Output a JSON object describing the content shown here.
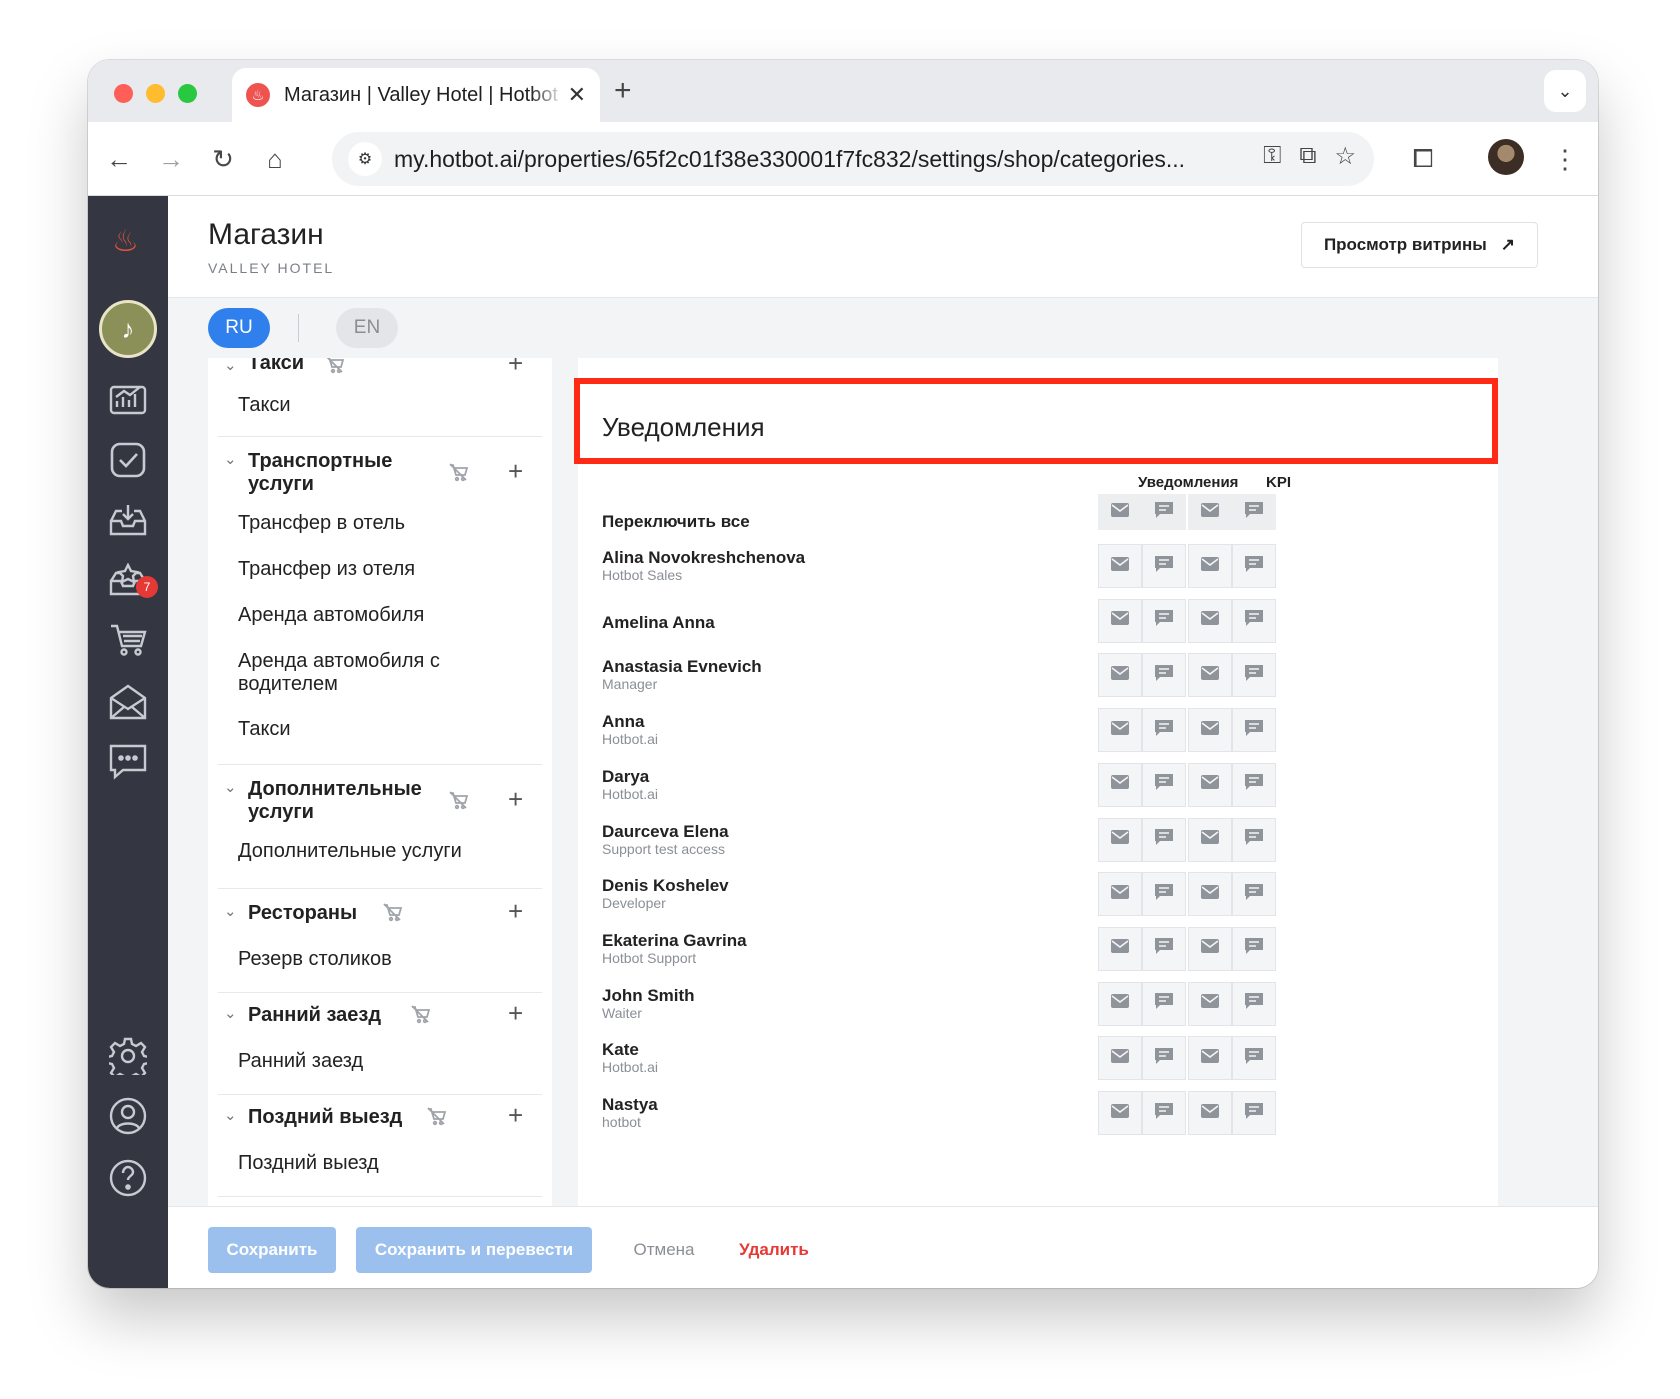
{
  "browser": {
    "tab_title": "Магазин | Valley Hotel | Hotbot",
    "url": "my.hotbot.ai/properties/65f2c01f38e330001f7fc832/settings/shop/categories...",
    "traffic_colors": [
      "#ff5f57",
      "#febc2e",
      "#28c840"
    ]
  },
  "header": {
    "title": "Магазин",
    "subtitle": "VALLEY HOTEL",
    "showcase_button": "Просмотр витрины",
    "showcase_arrow": "↗"
  },
  "languages": [
    {
      "code": "RU",
      "active": true
    },
    {
      "code": "EN",
      "active": false
    }
  ],
  "sidebar": {
    "badge_count": "7",
    "items": [
      "analytics-icon",
      "tasks-icon",
      "inbox-icon",
      "reviews-icon",
      "cart-icon",
      "mail-icon",
      "chat-icon",
      "settings-icon",
      "profile-icon",
      "help-icon"
    ]
  },
  "categories": [
    {
      "name": "Такси",
      "items": [
        "Такси"
      ]
    },
    {
      "name": "Транспортные услуги",
      "items": [
        "Трансфер в отель",
        "Трансфер из отеля",
        "Аренда автомобиля",
        "Аренда автомобиля с водителем",
        "Такси"
      ]
    },
    {
      "name": "Дополнительные услуги",
      "items": [
        "Дополнительные услуги"
      ]
    },
    {
      "name": "Рестораны",
      "items": [
        "Резерв столиков"
      ]
    },
    {
      "name": "Ранний заезд",
      "items": [
        "Ранний заезд"
      ]
    },
    {
      "name": "Поздний выезд",
      "items": [
        "Поздний выезд"
      ]
    }
  ],
  "notifications": {
    "title": "Уведомления",
    "col_notifications": "Уведомления",
    "col_kpi": "KPI",
    "toggle_all": "Переключить все",
    "users": [
      {
        "name": "Alina Novokreshchenova",
        "role": "Hotbot Sales"
      },
      {
        "name": "Amelina Anna",
        "role": ""
      },
      {
        "name": "Anastasia Evnevich",
        "role": "Manager"
      },
      {
        "name": "Anna",
        "role": "Hotbot.ai"
      },
      {
        "name": "Darya",
        "role": "Hotbot.ai"
      },
      {
        "name": "Daurceva Elena",
        "role": "Support test access"
      },
      {
        "name": "Denis Koshelev",
        "role": "Developer"
      },
      {
        "name": "Ekaterina Gavrina",
        "role": "Hotbot Support"
      },
      {
        "name": "John Smith",
        "role": "Waiter"
      },
      {
        "name": "Kate",
        "role": "Hotbot.ai"
      },
      {
        "name": "Nastya",
        "role": "hotbot"
      }
    ]
  },
  "footer": {
    "save": "Сохранить",
    "save_translate": "Сохранить и перевести",
    "cancel": "Отмена",
    "delete": "Удалить"
  },
  "colors": {
    "accent": "#2f80ed",
    "highlight": "#ff2a16",
    "danger": "#e53935",
    "sidebar": "#343741"
  }
}
